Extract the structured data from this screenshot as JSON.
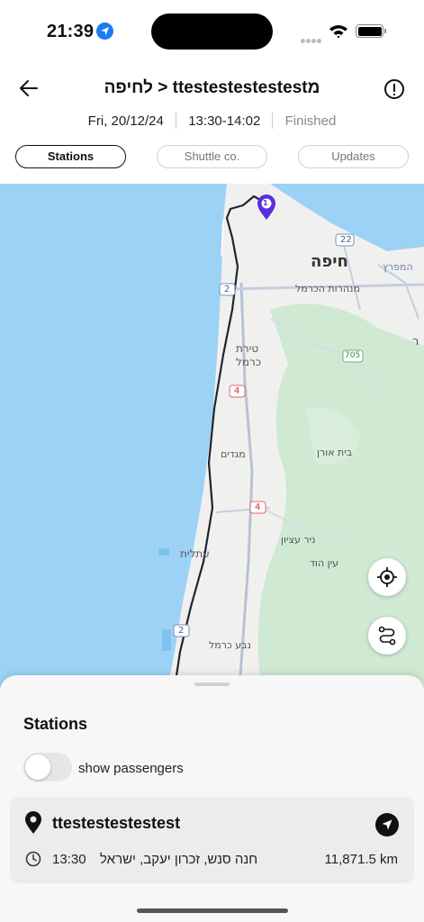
{
  "status_bar": {
    "time": "21:39"
  },
  "header": {
    "route_title": "מttestestestestest < לחיפה",
    "date": "Fri, 20/12/24",
    "time_range": "13:30-14:02",
    "status": "Finished"
  },
  "tabs": [
    {
      "label": "Stations",
      "active": true
    },
    {
      "label": "Shuttle co.",
      "active": false
    },
    {
      "label": "Updates",
      "active": false
    }
  ],
  "map": {
    "city": "חיפה",
    "labels": {
      "nahariya": "מנהרות הכרמל",
      "tirat": "טירת",
      "carmel": "כרמל",
      "migdim": "מגדים",
      "beit_oren": "בית אורן",
      "nir_etzion": "ניר עציון",
      "ein_hod": "עין הוד",
      "atlit": "עתלית",
      "neve_carmel": "נבע כרמל",
      "hamifratz": "המפרץ",
      "edge_right": "ר"
    },
    "road_numbers": {
      "r22": "22",
      "r2a": "2",
      "r705": "705",
      "r4a": "4",
      "r4b": "4",
      "r2b": "2"
    },
    "marker_label": "1",
    "colors": {
      "water": "#9cd2f6",
      "land": "#f0f1ef",
      "green": "#cfe9d3",
      "route": "#1f2530",
      "marker": "#5b2ee0"
    }
  },
  "sheet": {
    "title": "Stations",
    "toggle_label": "show passengers",
    "toggle_on": false,
    "station": {
      "name": "ttestestestestest",
      "time": "13:30",
      "address": "חנה סנש, זכרון יעקב, ישראל",
      "distance": "11,871.5 km"
    }
  }
}
